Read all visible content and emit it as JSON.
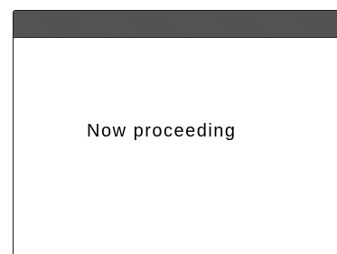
{
  "dialog": {
    "title": "",
    "message": "Now proceeding"
  },
  "colors": {
    "title_bar": "#4a4a4a",
    "background": "#ffffff",
    "text": "#000000"
  }
}
